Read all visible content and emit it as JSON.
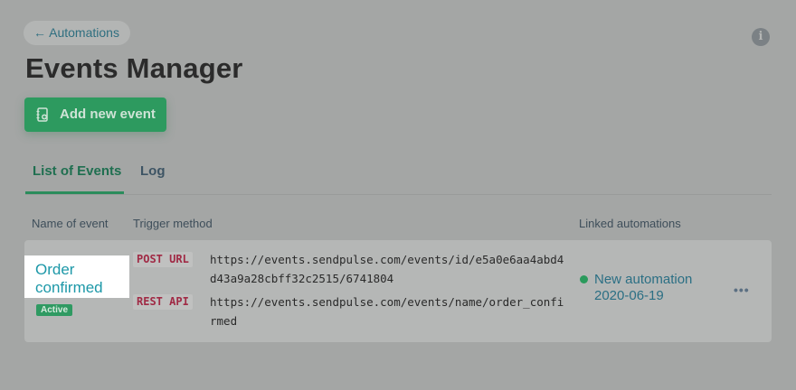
{
  "back_link": {
    "label": "← Automations"
  },
  "header": {
    "title": "Events Manager",
    "info_icon": "info-circle-icon",
    "info_glyph": "i"
  },
  "actions": {
    "add_event_label": "Add new event",
    "add_event_icon": "notebook-add-icon"
  },
  "tabs": [
    {
      "label": "List of Events",
      "active": true
    },
    {
      "label": "Log",
      "active": false
    }
  ],
  "table": {
    "columns": [
      "Name of event",
      "Trigger method",
      "Linked automations"
    ],
    "rows": [
      {
        "name": "Order confirmed",
        "status": "Active",
        "triggers": [
          {
            "method": "POST URL",
            "value": "https://events.sendpulse.com/events/id/e5a0e6aa4abd4d43a9a28cbff32c2515/6741804"
          },
          {
            "method": "REST API",
            "value": "https://events.sendpulse.com/events/name/order_confirmed"
          }
        ],
        "linked_automation": "New automation 2020-06-19",
        "more_icon": "more-horizontal-icon",
        "more_glyph": "•••"
      }
    ]
  },
  "colors": {
    "accent_green": "#2d9a5f",
    "link_teal": "#1d98a8",
    "method_red": "#a02a45",
    "overlay_grey": "#a4a6a5"
  }
}
